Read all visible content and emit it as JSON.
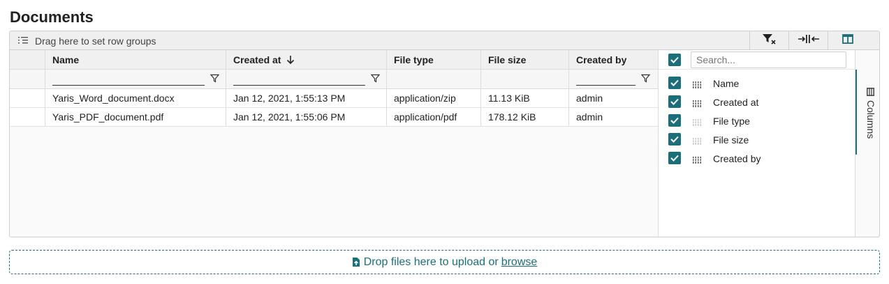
{
  "page": {
    "title": "Documents"
  },
  "toolbar": {
    "group_drop_label": "Drag here to set row groups",
    "clear_filters_icon": "filter-clear-icon",
    "autosize_icon": "autosize-columns-icon",
    "column_panel_icon": "columns-panel-icon"
  },
  "columns": [
    {
      "key": "name",
      "label": "Name",
      "sort": ""
    },
    {
      "key": "created_at",
      "label": "Created at",
      "sort": "desc"
    },
    {
      "key": "file_type",
      "label": "File type",
      "sort": ""
    },
    {
      "key": "file_size",
      "label": "File size",
      "sort": ""
    },
    {
      "key": "created_by",
      "label": "Created by",
      "sort": ""
    }
  ],
  "rows": [
    {
      "name": "Yaris_Word_document.docx",
      "created_at": "Jan 12, 2021, 1:55:13 PM",
      "file_type": "application/zip",
      "file_size": "11.13 KiB",
      "created_by": "admin"
    },
    {
      "name": "Yaris_PDF_document.pdf",
      "created_at": "Jan 12, 2021, 1:55:06 PM",
      "file_type": "application/pdf",
      "file_size": "178.12 KiB",
      "created_by": "admin"
    }
  ],
  "column_panel": {
    "search_placeholder": "Search...",
    "tab_label": "Columns",
    "items": [
      {
        "label": "Name",
        "checked": true
      },
      {
        "label": "Created at",
        "checked": true
      },
      {
        "label": "File type",
        "checked": true
      },
      {
        "label": "File size",
        "checked": true
      },
      {
        "label": "Created by",
        "checked": true
      }
    ]
  },
  "dropzone": {
    "text": "Drop files here to upload or",
    "link": "browse",
    "icon": "file-upload-icon"
  },
  "colors": {
    "accent": "#1b6f7a",
    "header_bg": "#f0f0f0",
    "border": "#cfcfcf"
  }
}
